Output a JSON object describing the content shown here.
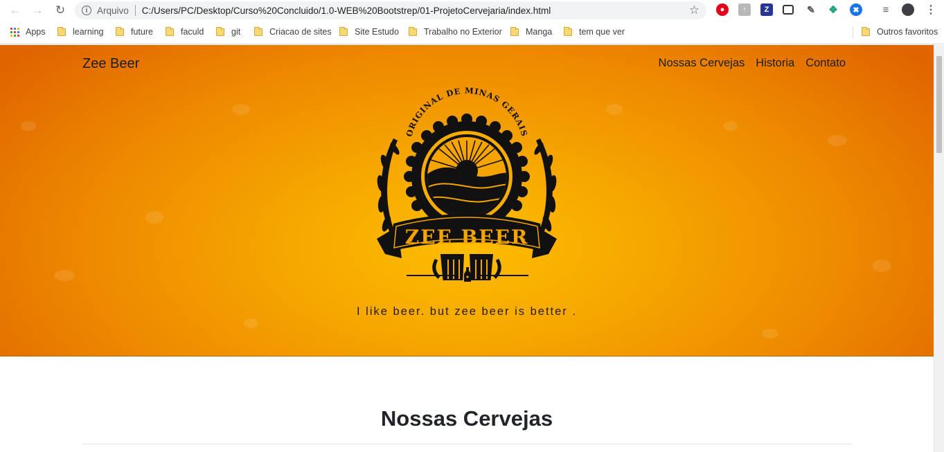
{
  "browser": {
    "scheme_label": "Arquivo",
    "url": "C:/Users/PC/Desktop/Curso%20Concluido/1.0-WEB%20Bootstrep/01-ProjetoCervejaria/index.html"
  },
  "bookmarks": {
    "apps_label": "Apps",
    "items": [
      "learning",
      "future",
      "faculd",
      "git",
      "Criacao de sites",
      "Site Estudo",
      "Trabalho no Exterior",
      "Manga",
      "tem que ver"
    ],
    "other_label": "Outros favoritos"
  },
  "page": {
    "brand": "Zee Beer",
    "nav": [
      "Nossas Cervejas",
      "Historia",
      "Contato"
    ],
    "logo": {
      "top_text": "ORIGINAL DE MINAS GERAIS",
      "banner_text": "ZEE BEER"
    },
    "tagline": "I like beer. but zee beer is better .",
    "section_title": "Nossas Cervejas"
  },
  "colors": {
    "hero_center": "#fdbd00",
    "hero_edge": "#e06500",
    "logo_ink": "#111111"
  }
}
